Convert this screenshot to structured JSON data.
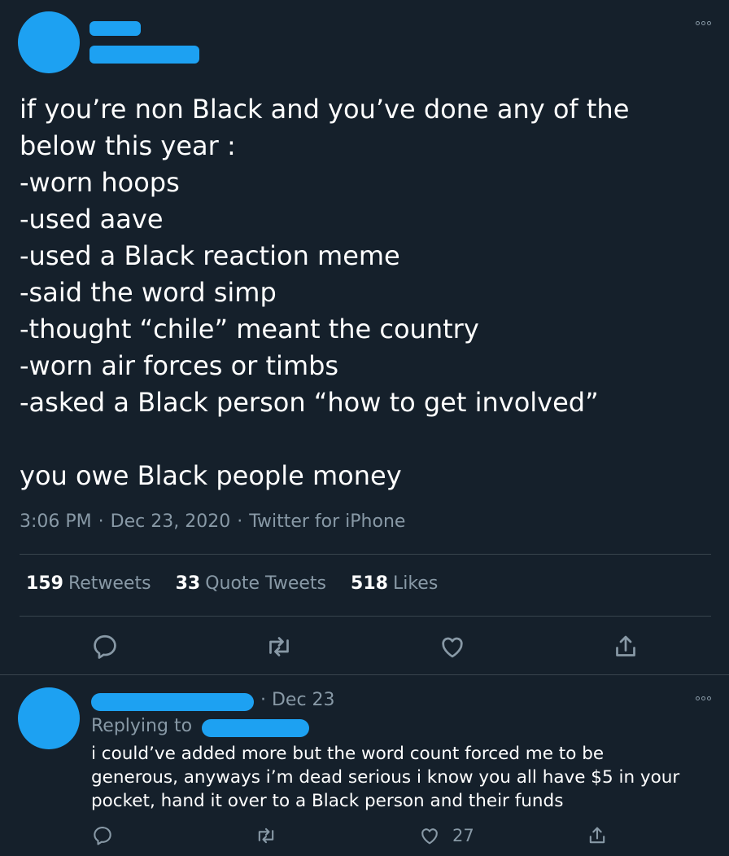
{
  "tweet": {
    "lines": [
      "if you’re non Black and you’ve done any of the",
      "below this year :",
      "-worn hoops",
      "-used aave",
      "-used a Black reaction meme",
      "-said the word simp",
      "-thought “chile” meant the country",
      "-worn air forces or timbs",
      "-asked a Black person “how to get involved”",
      "",
      "you owe Black people money"
    ],
    "time": "3:06 PM",
    "dot1": "·",
    "date": "Dec 23, 2020",
    "dot2": "·",
    "client": "Twitter for iPhone",
    "stats": {
      "retweets_count": "159",
      "retweets_label": "Retweets",
      "quotes_count": "33",
      "quotes_label": "Quote Tweets",
      "likes_count": "518",
      "likes_label": "Likes"
    }
  },
  "reply": {
    "date": "· Dec 23",
    "replying_label": "Replying to",
    "lines": [
      "i could’ve added more but the word count forced me to be",
      "generous, anyways i’m dead serious i know you all have $5 in your",
      "pocket, hand it over to a Black person and their funds"
    ],
    "like_count": "27"
  },
  "colors": {
    "background": "#15202b",
    "accent": "#1da1f2",
    "secondary_text": "#8899a6",
    "divider": "#38444d"
  },
  "icons": [
    "more-icon",
    "reply-icon",
    "retweet-icon",
    "like-icon",
    "share-icon"
  ]
}
